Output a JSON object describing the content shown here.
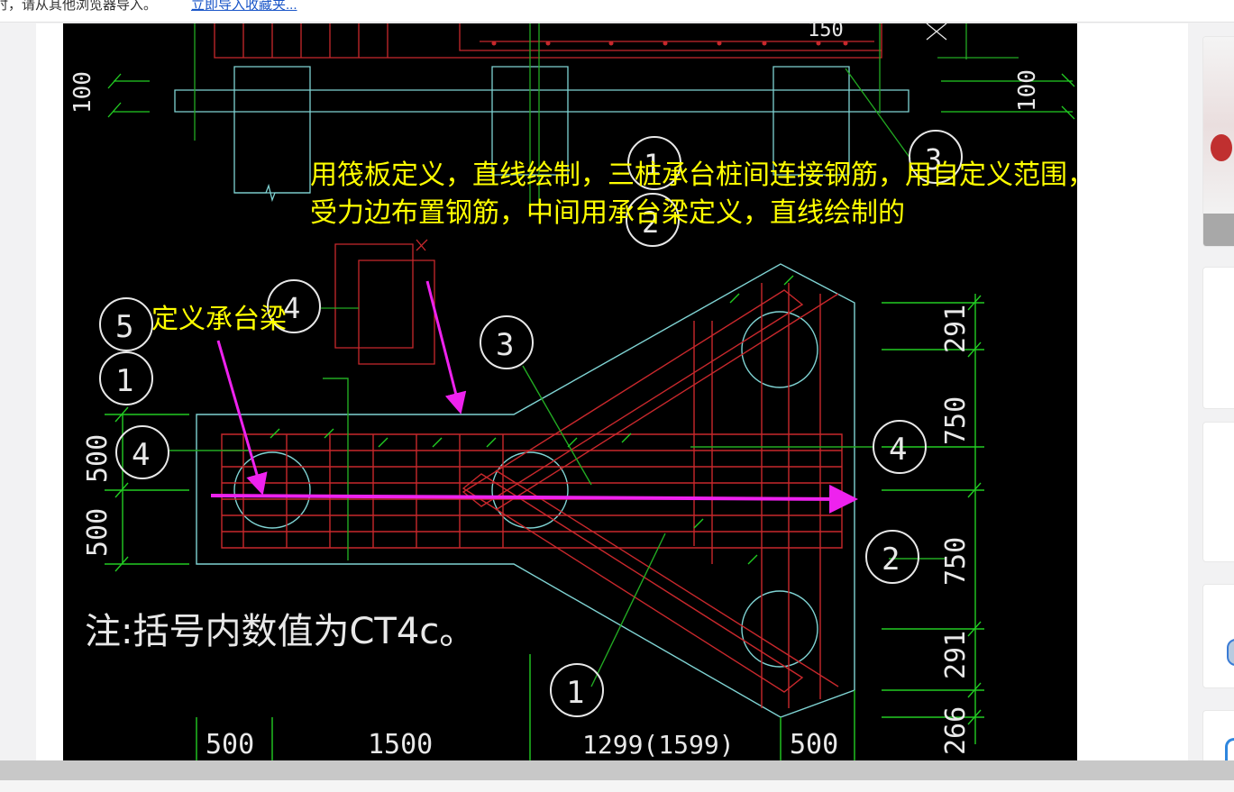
{
  "browser_notice": {
    "message": "时，请从其他浏览器导入。",
    "import_link": "立即导入收藏夹..."
  },
  "annotations": {
    "line1": "用筏板定义，直线绘制，三桩承台桩间连接钢筋，用自定义范围，平行",
    "line2": "受力边布置钢筋，中间用承台梁定义，直线绘制的",
    "beam_note": "定义承台梁"
  },
  "drawing": {
    "note": "注:括号内数值为CT4c。",
    "dims_bottom": [
      "500",
      "1500",
      "1299(1599)",
      "500"
    ],
    "dims_right": [
      "291",
      "750",
      "750",
      "291",
      "266"
    ],
    "dims_left": [
      "500",
      "500"
    ],
    "dims_top_left": "100",
    "dims_top_right": "100",
    "dims_top": "150",
    "callouts": [
      "1",
      "2",
      "3",
      "4",
      "5"
    ]
  },
  "colors": {
    "cad_background": "#000000",
    "concrete_outline": "#7fd3d3",
    "rebar": "#c8282c",
    "leader": "#22bb22",
    "dimension": "#22cc22",
    "annotation_text": "#ffff00",
    "arrow": "#ee22ee"
  }
}
